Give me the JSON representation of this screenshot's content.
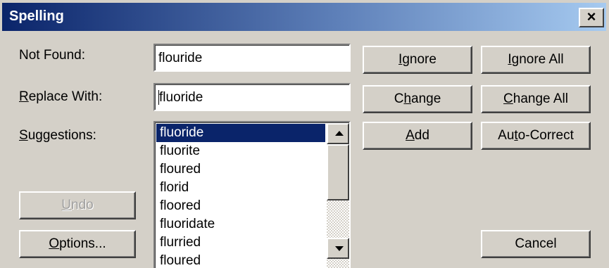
{
  "dialog": {
    "title": "Spelling",
    "close_glyph": "×",
    "close_icon": "close-icon"
  },
  "labels": {
    "not_found": "Not Found:",
    "replace_with_mnemonic": "R",
    "replace_with_rest": "eplace With:",
    "suggestions_mnemonic": "S",
    "suggestions_rest": "uggestions:"
  },
  "fields": {
    "not_found_value": "flouride",
    "replace_with_value": "fluoride"
  },
  "suggestions": {
    "items": [
      "fluoride",
      "fluorite",
      "floured",
      "florid",
      "floored",
      "fluoridate",
      "flurried",
      "floured"
    ],
    "selected": "fluoride",
    "scroll_up_icon": "scroll-up-arrow-icon",
    "scroll_down_icon": "scroll-down-arrow-icon"
  },
  "buttons": {
    "ignore": {
      "mnemonic": "I",
      "rest": "gnore"
    },
    "ignore_all": {
      "mnemonic": "I",
      "rest": "gnore All"
    },
    "change": {
      "pre": "C",
      "mnemonic": "h",
      "rest": "ange"
    },
    "change_all": {
      "mnemonic": "C",
      "rest": "hange All"
    },
    "add": {
      "mnemonic": "A",
      "rest": "dd"
    },
    "auto_correct": {
      "pre": "Au",
      "mnemonic": "t",
      "rest": "o-Correct"
    },
    "undo": {
      "mnemonic": "U",
      "rest": "ndo"
    },
    "options": {
      "mnemonic": "O",
      "rest": "ptions..."
    },
    "cancel": "Cancel"
  },
  "colors": {
    "face": "#d4d0c8",
    "title_start": "#0a246a",
    "title_end": "#a6caf0",
    "selection": "#0a246a"
  }
}
